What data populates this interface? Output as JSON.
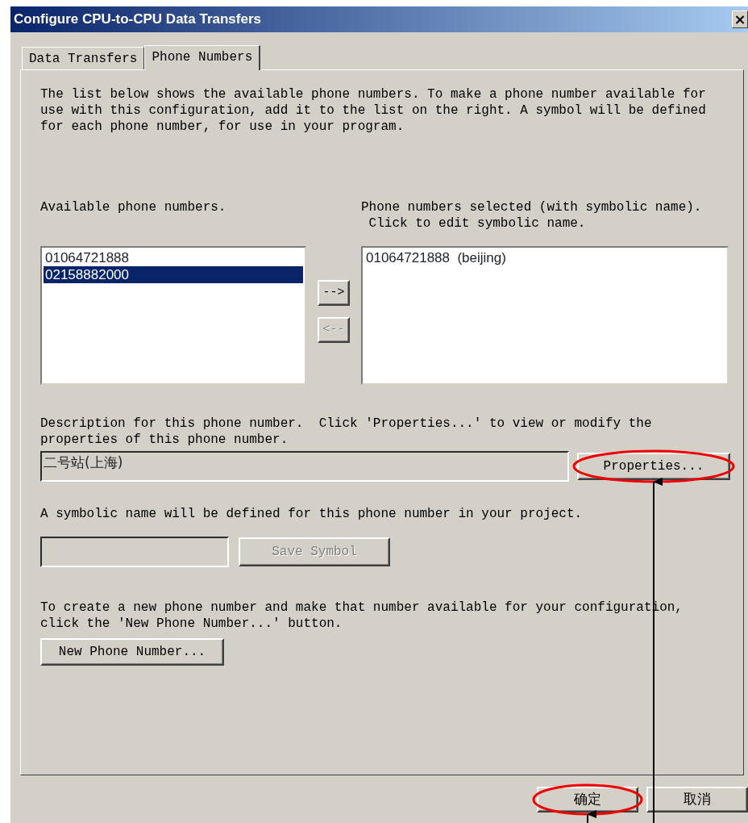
{
  "window": {
    "title": "Configure CPU-to-CPU Data Transfers",
    "close": "×"
  },
  "tabs": [
    {
      "label": "Data Transfers",
      "selected": false
    },
    {
      "label": "Phone Numbers",
      "selected": true
    }
  ],
  "intro": "The list below shows the available phone numbers. To make a phone number available for use with this configuration, add it to the list on the right. A symbol will be defined for each phone number, for use in your program.",
  "available": {
    "label": "Available phone numbers.",
    "items": [
      {
        "text": "01064721888",
        "selected": false
      },
      {
        "text": "02158882000",
        "selected": true
      }
    ]
  },
  "move_buttons": [
    {
      "label": "-->",
      "disabled": false
    },
    {
      "label": "<--",
      "disabled": true
    }
  ],
  "selected_list": {
    "label": "Phone numbers selected (with symbolic name).\n Click to edit symbolic name.",
    "items": [
      {
        "text": "01064721888  (beijing)",
        "selected": false
      }
    ]
  },
  "description": {
    "label": "Description for this phone number.  Click 'Properties...' to view or modify the properties of this phone number.",
    "value": "二号站(上海)"
  },
  "properties_button": {
    "label": "Properties...",
    "disabled": false,
    "annotated": true
  },
  "symbol": {
    "label": "A symbolic name will be defined for this phone number in your project."
  },
  "save_symbol_button": {
    "label": "Save Symbol",
    "disabled": true,
    "annotated": false
  },
  "new_number": {
    "label": "To create a new phone number and make that number available for your configuration, click the 'New Phone Number...' button."
  },
  "new_number_button": {
    "label": "New Phone Number...",
    "disabled": false,
    "annotated": false
  },
  "footer_buttons": [
    {
      "label": "确定",
      "disabled": false,
      "annotated": true
    },
    {
      "label": "取消",
      "disabled": false,
      "annotated": false
    }
  ]
}
